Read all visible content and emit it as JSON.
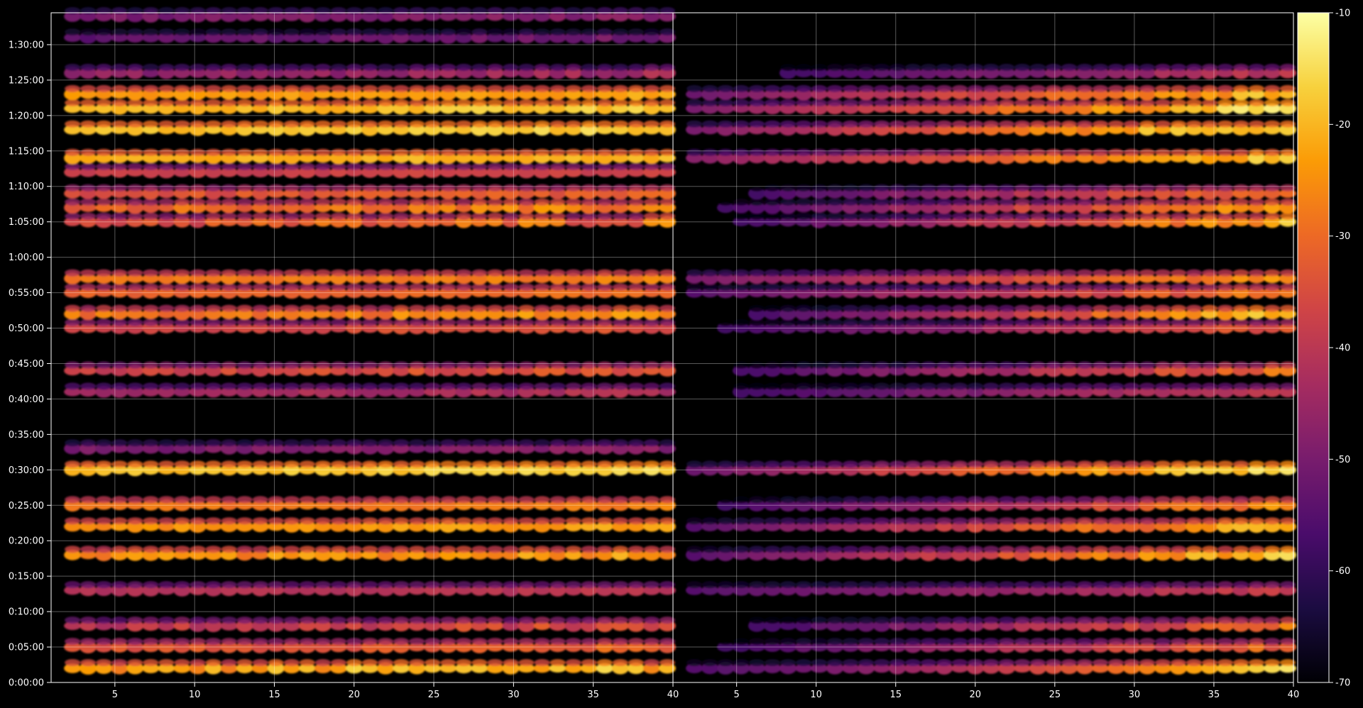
{
  "chart_data": [
    {
      "type": "heatmap",
      "panel": "left",
      "x_ticks": [
        "5",
        "10",
        "15",
        "20",
        "25",
        "30",
        "35",
        "40"
      ],
      "x_tick_values": [
        5,
        10,
        15,
        20,
        25,
        30,
        35,
        40
      ],
      "xlim": [
        1,
        40
      ],
      "y_ticks": [
        "0:00:00",
        "0:05:00",
        "0:10:00",
        "0:15:00",
        "0:20:00",
        "0:25:00",
        "0:30:00",
        "0:35:00",
        "0:40:00",
        "0:45:00",
        "0:50:00",
        "0:55:00",
        "1:00:00",
        "1:05:00",
        "1:10:00",
        "1:15:00",
        "1:20:00",
        "1:25:00",
        "1:30:00"
      ],
      "ylim": [
        "0:00:00",
        "1:34:30"
      ],
      "grid": true,
      "series": [
        {
          "time": "0:02:00",
          "value_by_x": "-20 to -12 (brightest at x 30-38)"
        },
        {
          "time": "0:05:00",
          "value_by_x": "-40 to -28"
        },
        {
          "time": "0:08:00",
          "value_by_x": "-50 to -30"
        },
        {
          "time": "0:13:00",
          "value_by_x": "-45 to -38"
        },
        {
          "time": "0:18:00",
          "value_by_x": "-35 to -18"
        },
        {
          "time": "0:22:00",
          "value_by_x": "-30 to -20"
        },
        {
          "time": "0:25:00",
          "value_by_x": "-32 to -25"
        },
        {
          "time": "0:30:00",
          "value_by_x": "-25 to -14"
        },
        {
          "time": "0:33:00",
          "value_by_x": "-55 to -45"
        },
        {
          "time": "0:41:00",
          "value_by_x": "-50 to -38"
        },
        {
          "time": "0:44:00",
          "value_by_x": "-45 to -30"
        },
        {
          "time": "0:50:00",
          "value_by_x": "-42 to -32"
        },
        {
          "time": "0:52:00",
          "value_by_x": "-38 to -20"
        },
        {
          "time": "0:55:00",
          "value_by_x": "-35 to -28"
        },
        {
          "time": "0:57:00",
          "value_by_x": "-32 to -25"
        },
        {
          "time": "1:05:00",
          "value_by_x": "-48 to -22"
        },
        {
          "time": "1:07:00",
          "value_by_x": "-40 to -22"
        },
        {
          "time": "1:09:00",
          "value_by_x": "-42 to -28"
        },
        {
          "time": "1:12:00",
          "value_by_x": "-42 to -35"
        },
        {
          "time": "1:14:00",
          "value_by_x": "-25 to -18"
        },
        {
          "time": "1:18:00",
          "value_by_x": "-25 to -14"
        },
        {
          "time": "1:21:00",
          "value_by_x": "-26 to -15"
        },
        {
          "time": "1:23:00",
          "value_by_x": "-28 to -20"
        },
        {
          "time": "1:26:00",
          "value_by_x": "-55 to -40"
        },
        {
          "time": "1:31:00",
          "value_by_x": "-58 to -48"
        },
        {
          "time": "1:34:00",
          "value_by_x": "-55 to -45"
        }
      ]
    },
    {
      "type": "heatmap",
      "panel": "right",
      "x_ticks": [
        "5",
        "10",
        "15",
        "20",
        "25",
        "30",
        "35",
        "40"
      ],
      "x_tick_values": [
        5,
        10,
        15,
        20,
        25,
        30,
        35,
        40
      ],
      "xlim": [
        1,
        40
      ],
      "ylim": [
        "0:00:00",
        "1:34:30"
      ],
      "grid": true,
      "series": [
        {
          "time": "0:02:00",
          "value_by_x": "-55 (x<15) rising to -14 (x 30-38)"
        },
        {
          "time": "0:05:00",
          "value_by_x": "-60 to -30"
        },
        {
          "time": "0:08:00",
          "value_by_x": "-62 to -30"
        },
        {
          "time": "0:13:00",
          "value_by_x": "-55 to -38"
        },
        {
          "time": "0:18:00",
          "value_by_x": "-55 to -18"
        },
        {
          "time": "0:22:00",
          "value_by_x": "-55 to -20"
        },
        {
          "time": "0:25:00",
          "value_by_x": "-60 to -25"
        },
        {
          "time": "0:30:00",
          "value_by_x": "-52 to -14"
        },
        {
          "time": "0:41:00",
          "value_by_x": "-60 to -38"
        },
        {
          "time": "0:44:00",
          "value_by_x": "-60 to -30"
        },
        {
          "time": "0:50:00",
          "value_by_x": "-60 to -32"
        },
        {
          "time": "0:52:00",
          "value_by_x": "-62 to -20"
        },
        {
          "time": "0:55:00",
          "value_by_x": "-55 to -28"
        },
        {
          "time": "0:57:00",
          "value_by_x": "-50 to -25"
        },
        {
          "time": "1:05:00",
          "value_by_x": "-62 to -22"
        },
        {
          "time": "1:07:00",
          "value_by_x": "-60 to -22"
        },
        {
          "time": "1:09:00",
          "value_by_x": "-62 to -28"
        },
        {
          "time": "1:14:00",
          "value_by_x": "-48 to -18"
        },
        {
          "time": "1:18:00",
          "value_by_x": "-50 to -14"
        },
        {
          "time": "1:21:00",
          "value_by_x": "-50 to -15"
        },
        {
          "time": "1:23:00",
          "value_by_x": "-52 to -20"
        },
        {
          "time": "1:26:00",
          "value_by_x": "-62 to -40"
        }
      ]
    }
  ],
  "colorbar": {
    "ticks": [
      "-10",
      "-20",
      "-30",
      "-40",
      "-50",
      "-60",
      "-70"
    ],
    "tick_values": [
      -10,
      -20,
      -30,
      -40,
      -50,
      -60,
      -70
    ],
    "range": [
      -70,
      -10
    ],
    "colormap": "inferno",
    "stops": [
      "#000004",
      "#1b0c41",
      "#4a0c6b",
      "#781c6d",
      "#a52c60",
      "#cf4446",
      "#ed6925",
      "#fb9b06",
      "#f7d13d",
      "#fcffa4"
    ]
  },
  "style": {
    "background": "#000000",
    "grid_color": "#ffffff",
    "text_color": "#ffffff"
  }
}
